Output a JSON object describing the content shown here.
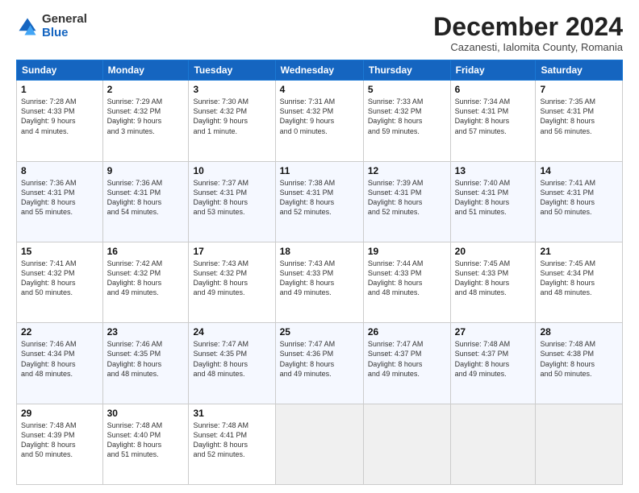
{
  "logo": {
    "general": "General",
    "blue": "Blue"
  },
  "title": "December 2024",
  "subtitle": "Cazanesti, Ialomita County, Romania",
  "header_days": [
    "Sunday",
    "Monday",
    "Tuesday",
    "Wednesday",
    "Thursday",
    "Friday",
    "Saturday"
  ],
  "weeks": [
    [
      {
        "day": "1",
        "info": "Sunrise: 7:28 AM\nSunset: 4:33 PM\nDaylight: 9 hours\nand 4 minutes."
      },
      {
        "day": "2",
        "info": "Sunrise: 7:29 AM\nSunset: 4:32 PM\nDaylight: 9 hours\nand 3 minutes."
      },
      {
        "day": "3",
        "info": "Sunrise: 7:30 AM\nSunset: 4:32 PM\nDaylight: 9 hours\nand 1 minute."
      },
      {
        "day": "4",
        "info": "Sunrise: 7:31 AM\nSunset: 4:32 PM\nDaylight: 9 hours\nand 0 minutes."
      },
      {
        "day": "5",
        "info": "Sunrise: 7:33 AM\nSunset: 4:32 PM\nDaylight: 8 hours\nand 59 minutes."
      },
      {
        "day": "6",
        "info": "Sunrise: 7:34 AM\nSunset: 4:31 PM\nDaylight: 8 hours\nand 57 minutes."
      },
      {
        "day": "7",
        "info": "Sunrise: 7:35 AM\nSunset: 4:31 PM\nDaylight: 8 hours\nand 56 minutes."
      }
    ],
    [
      {
        "day": "8",
        "info": "Sunrise: 7:36 AM\nSunset: 4:31 PM\nDaylight: 8 hours\nand 55 minutes."
      },
      {
        "day": "9",
        "info": "Sunrise: 7:36 AM\nSunset: 4:31 PM\nDaylight: 8 hours\nand 54 minutes."
      },
      {
        "day": "10",
        "info": "Sunrise: 7:37 AM\nSunset: 4:31 PM\nDaylight: 8 hours\nand 53 minutes."
      },
      {
        "day": "11",
        "info": "Sunrise: 7:38 AM\nSunset: 4:31 PM\nDaylight: 8 hours\nand 52 minutes."
      },
      {
        "day": "12",
        "info": "Sunrise: 7:39 AM\nSunset: 4:31 PM\nDaylight: 8 hours\nand 52 minutes."
      },
      {
        "day": "13",
        "info": "Sunrise: 7:40 AM\nSunset: 4:31 PM\nDaylight: 8 hours\nand 51 minutes."
      },
      {
        "day": "14",
        "info": "Sunrise: 7:41 AM\nSunset: 4:31 PM\nDaylight: 8 hours\nand 50 minutes."
      }
    ],
    [
      {
        "day": "15",
        "info": "Sunrise: 7:41 AM\nSunset: 4:32 PM\nDaylight: 8 hours\nand 50 minutes."
      },
      {
        "day": "16",
        "info": "Sunrise: 7:42 AM\nSunset: 4:32 PM\nDaylight: 8 hours\nand 49 minutes."
      },
      {
        "day": "17",
        "info": "Sunrise: 7:43 AM\nSunset: 4:32 PM\nDaylight: 8 hours\nand 49 minutes."
      },
      {
        "day": "18",
        "info": "Sunrise: 7:43 AM\nSunset: 4:33 PM\nDaylight: 8 hours\nand 49 minutes."
      },
      {
        "day": "19",
        "info": "Sunrise: 7:44 AM\nSunset: 4:33 PM\nDaylight: 8 hours\nand 48 minutes."
      },
      {
        "day": "20",
        "info": "Sunrise: 7:45 AM\nSunset: 4:33 PM\nDaylight: 8 hours\nand 48 minutes."
      },
      {
        "day": "21",
        "info": "Sunrise: 7:45 AM\nSunset: 4:34 PM\nDaylight: 8 hours\nand 48 minutes."
      }
    ],
    [
      {
        "day": "22",
        "info": "Sunrise: 7:46 AM\nSunset: 4:34 PM\nDaylight: 8 hours\nand 48 minutes."
      },
      {
        "day": "23",
        "info": "Sunrise: 7:46 AM\nSunset: 4:35 PM\nDaylight: 8 hours\nand 48 minutes."
      },
      {
        "day": "24",
        "info": "Sunrise: 7:47 AM\nSunset: 4:35 PM\nDaylight: 8 hours\nand 48 minutes."
      },
      {
        "day": "25",
        "info": "Sunrise: 7:47 AM\nSunset: 4:36 PM\nDaylight: 8 hours\nand 49 minutes."
      },
      {
        "day": "26",
        "info": "Sunrise: 7:47 AM\nSunset: 4:37 PM\nDaylight: 8 hours\nand 49 minutes."
      },
      {
        "day": "27",
        "info": "Sunrise: 7:48 AM\nSunset: 4:37 PM\nDaylight: 8 hours\nand 49 minutes."
      },
      {
        "day": "28",
        "info": "Sunrise: 7:48 AM\nSunset: 4:38 PM\nDaylight: 8 hours\nand 50 minutes."
      }
    ],
    [
      {
        "day": "29",
        "info": "Sunrise: 7:48 AM\nSunset: 4:39 PM\nDaylight: 8 hours\nand 50 minutes."
      },
      {
        "day": "30",
        "info": "Sunrise: 7:48 AM\nSunset: 4:40 PM\nDaylight: 8 hours\nand 51 minutes."
      },
      {
        "day": "31",
        "info": "Sunrise: 7:48 AM\nSunset: 4:41 PM\nDaylight: 8 hours\nand 52 minutes."
      },
      {
        "day": "",
        "info": ""
      },
      {
        "day": "",
        "info": ""
      },
      {
        "day": "",
        "info": ""
      },
      {
        "day": "",
        "info": ""
      }
    ]
  ]
}
